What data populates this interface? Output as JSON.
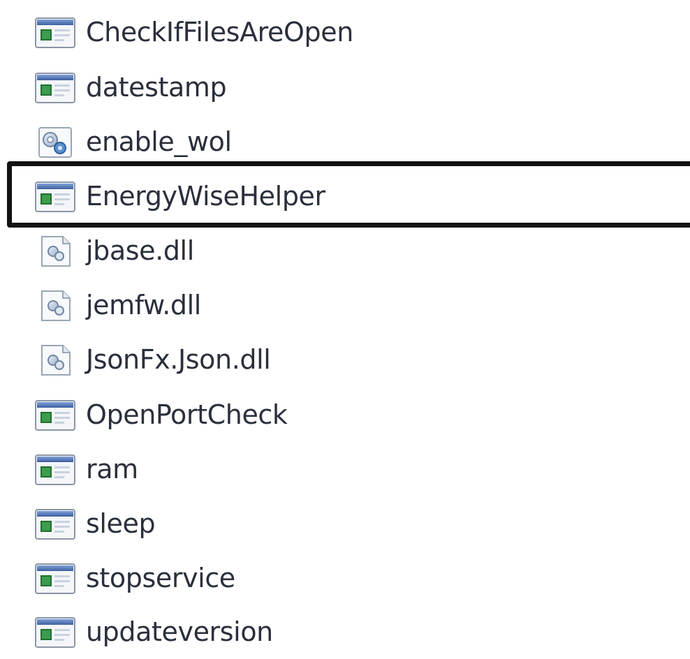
{
  "files": [
    {
      "name": "CheckIfFilesAreOpen",
      "icon": "application-icon"
    },
    {
      "name": "datestamp",
      "icon": "application-icon"
    },
    {
      "name": "enable_wol",
      "icon": "settings-file-icon"
    },
    {
      "name": "EnergyWiseHelper",
      "icon": "application-icon",
      "selected": true
    },
    {
      "name": "jbase.dll",
      "icon": "dll-file-icon"
    },
    {
      "name": "jemfw.dll",
      "icon": "dll-file-icon"
    },
    {
      "name": "JsonFx.Json.dll",
      "icon": "dll-file-icon"
    },
    {
      "name": "OpenPortCheck",
      "icon": "application-icon"
    },
    {
      "name": "ram",
      "icon": "application-icon"
    },
    {
      "name": "sleep",
      "icon": "application-icon"
    },
    {
      "name": "stopservice",
      "icon": "application-icon"
    },
    {
      "name": "updateversion",
      "icon": "application-icon"
    }
  ],
  "colors": {
    "text": "#2a2f3c",
    "selection_border": "#111111",
    "app_icon_titlebar": "#4a6fb0",
    "app_icon_accent": "#2e8b3a"
  }
}
